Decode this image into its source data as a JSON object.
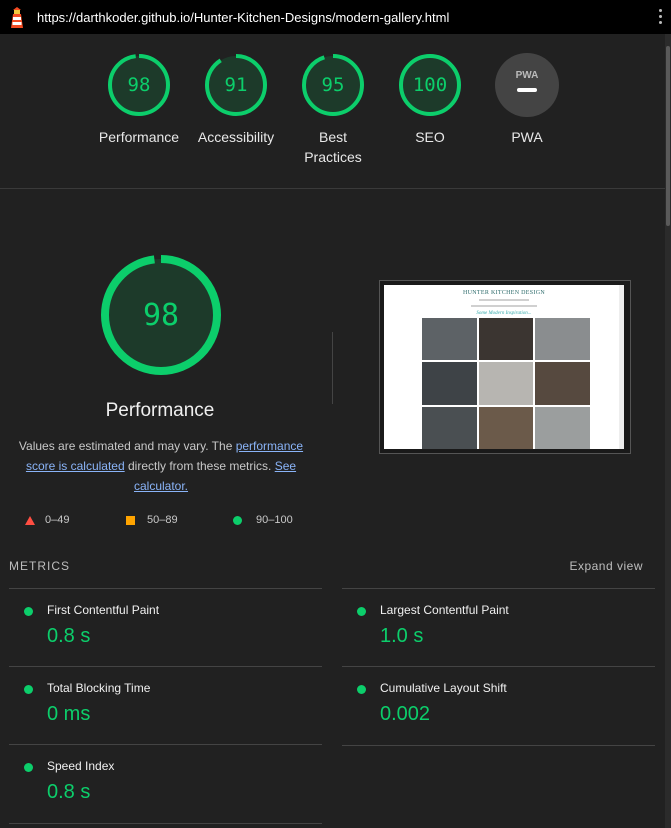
{
  "browser": {
    "url": "https://darthkoder.github.io/Hunter-Kitchen-Designs/modern-gallery.html"
  },
  "categories": [
    {
      "label": "Performance",
      "score": "98",
      "value": 98
    },
    {
      "label": "Accessibility",
      "score": "91",
      "value": 91
    },
    {
      "label": "Best Practices",
      "score": "95",
      "value": 95
    },
    {
      "label": "SEO",
      "score": "100",
      "value": 100
    },
    {
      "label": "PWA",
      "score": "",
      "value": null
    }
  ],
  "pwa_badge": "PWA",
  "performance": {
    "score": "98",
    "value": 98,
    "title": "Performance",
    "desc_1": "Values are estimated and may vary. The ",
    "link_1": "performance score is calculated",
    "desc_2": " directly from these metrics. ",
    "link_2": "See calculator."
  },
  "screenshot": {
    "title": "HUNTER KITCHEN DESIGN",
    "subtitle": "Some Modern Inspiration..."
  },
  "legend": {
    "fail": "0–49",
    "average": "50–89",
    "pass": "90–100"
  },
  "metrics": {
    "heading": "METRICS",
    "expand_label": "Expand view",
    "items": [
      {
        "name": "First Contentful Paint",
        "value": "0.8 s"
      },
      {
        "name": "Largest Contentful Paint",
        "value": "1.0 s"
      },
      {
        "name": "Total Blocking Time",
        "value": "0 ms"
      },
      {
        "name": "Cumulative Layout Shift",
        "value": "0.002"
      },
      {
        "name": "Speed Index",
        "value": "0.8 s"
      }
    ]
  },
  "colors": {
    "pass": "#0cce6b",
    "average": "#ffa400",
    "fail": "#ff4e42",
    "link": "#8ab4f8"
  }
}
